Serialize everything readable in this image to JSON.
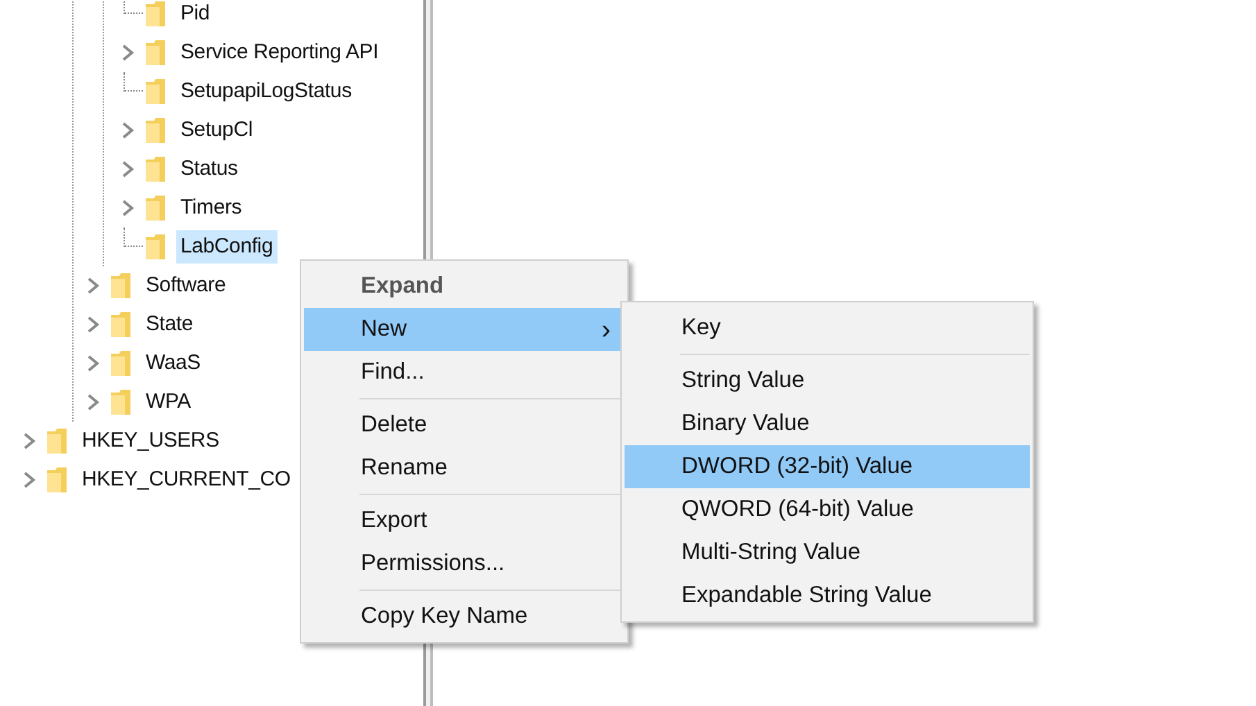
{
  "tree": {
    "items": [
      {
        "children": [
          {
            "children": [
              {
                "label": "Pid",
                "expandable": false,
                "selected": false
              },
              {
                "label": "Service Reporting API",
                "expandable": true,
                "selected": false
              },
              {
                "label": "SetupapiLogStatus",
                "expandable": false,
                "selected": false
              },
              {
                "label": "SetupCl",
                "expandable": true,
                "selected": false
              },
              {
                "label": "Status",
                "expandable": true,
                "selected": false
              },
              {
                "label": "Timers",
                "expandable": true,
                "selected": false
              },
              {
                "label": "LabConfig",
                "expandable": false,
                "selected": true
              }
            ]
          },
          {
            "label": "Software",
            "expandable": true,
            "selected": false
          },
          {
            "label": "State",
            "expandable": true,
            "selected": false
          },
          {
            "label": "WaaS",
            "expandable": true,
            "selected": false
          },
          {
            "label": "WPA",
            "expandable": true,
            "selected": false
          }
        ]
      },
      {
        "label": "HKEY_USERS",
        "expandable": true,
        "selected": false
      },
      {
        "label": "HKEY_CURRENT_CO",
        "expandable": true,
        "selected": false
      }
    ]
  },
  "context_menu": {
    "items": [
      {
        "kind": "item",
        "label": "Expand",
        "bold": true,
        "selected": false
      },
      {
        "kind": "item",
        "label": "New",
        "submenu_arrow": "›",
        "selected": true
      },
      {
        "kind": "item",
        "label": "Find...",
        "selected": false
      },
      {
        "kind": "separator"
      },
      {
        "kind": "item",
        "label": "Delete",
        "selected": false
      },
      {
        "kind": "item",
        "label": "Rename",
        "selected": false
      },
      {
        "kind": "separator"
      },
      {
        "kind": "item",
        "label": "Export",
        "selected": false
      },
      {
        "kind": "item",
        "label": "Permissions...",
        "selected": false
      },
      {
        "kind": "separator"
      },
      {
        "kind": "item",
        "label": "Copy Key Name",
        "selected": false
      }
    ]
  },
  "submenu": {
    "items": [
      {
        "kind": "item",
        "label": "Key",
        "selected": false
      },
      {
        "kind": "separator"
      },
      {
        "kind": "item",
        "label": "String Value",
        "selected": false
      },
      {
        "kind": "item",
        "label": "Binary Value",
        "selected": false
      },
      {
        "kind": "item",
        "label": "DWORD (32-bit) Value",
        "selected": true
      },
      {
        "kind": "item",
        "label": "QWORD (64-bit) Value",
        "selected": false
      },
      {
        "kind": "item",
        "label": "Multi-String Value",
        "selected": false
      },
      {
        "kind": "item",
        "label": "Expandable String Value",
        "selected": false
      }
    ]
  }
}
